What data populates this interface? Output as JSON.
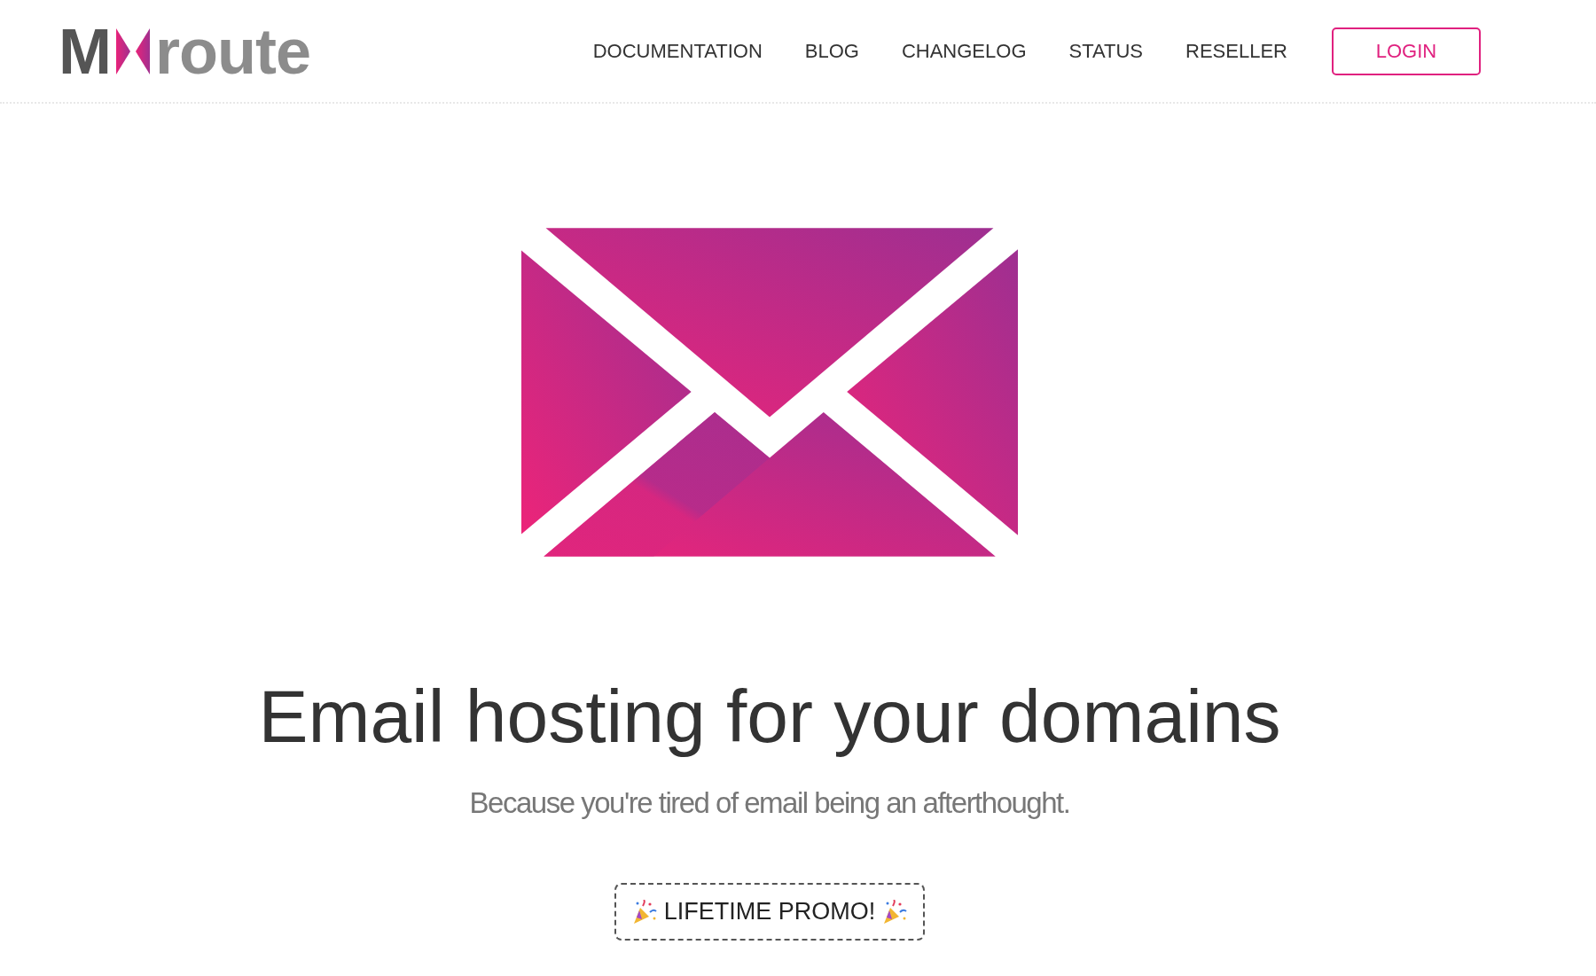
{
  "logo": {
    "left": "M",
    "right": "route"
  },
  "nav": [
    {
      "label": "DOCUMENTATION"
    },
    {
      "label": "BLOG"
    },
    {
      "label": "CHANGELOG"
    },
    {
      "label": "STATUS"
    },
    {
      "label": "RESELLER"
    }
  ],
  "login_button": "LOGIN",
  "hero": {
    "title": "Email hosting for your domains",
    "subtitle": "Because you're tired of email being an afterthought.",
    "promo_button": "LIFETIME PROMO!"
  }
}
